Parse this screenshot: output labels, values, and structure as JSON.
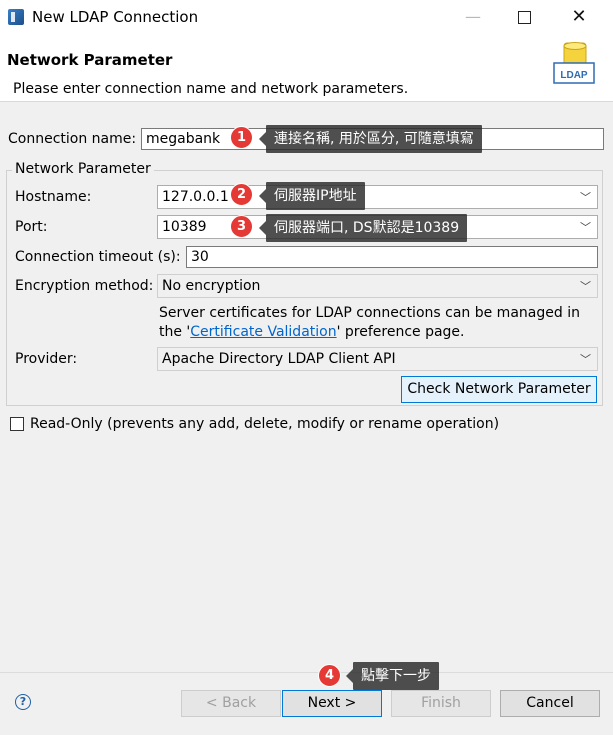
{
  "window": {
    "title": "New LDAP Connection",
    "minimize_symbol": "—",
    "close_symbol": "✕"
  },
  "header": {
    "title": "Network Parameter",
    "description": "Please enter connection name and network parameters.",
    "logo_text": "LDAP"
  },
  "form": {
    "connection_name": {
      "label": "Connection name:",
      "value": "megabank"
    },
    "group_title": "Network Parameter",
    "hostname": {
      "label": "Hostname:",
      "value": "127.0.0.1"
    },
    "port": {
      "label": "Port:",
      "value": "10389"
    },
    "timeout": {
      "label": "Connection timeout (s):",
      "value": "30"
    },
    "encryption": {
      "label": "Encryption method:",
      "value": "No encryption"
    },
    "cert_note": {
      "line1": "Server certificates for LDAP connections can be managed in",
      "line2_prefix": "the '",
      "link": "Certificate Validation",
      "line2_suffix": "' preference page."
    },
    "provider": {
      "label": "Provider:",
      "value": "Apache Directory LDAP Client API"
    },
    "check_button": "Check Network Parameter",
    "readonly_label": "Read-Only (prevents any add, delete, modify or rename operation)"
  },
  "footer": {
    "help_symbol": "?",
    "back": "< Back",
    "next": "Next >",
    "finish": "Finish",
    "cancel": "Cancel"
  },
  "annotations": [
    {
      "num": "1",
      "text": "連接名稱, 用於區分, 可隨意填寫"
    },
    {
      "num": "2",
      "text": "伺服器IP地址"
    },
    {
      "num": "3",
      "text": "伺服器端口, DS默認是10389"
    },
    {
      "num": "4",
      "text": "點擊下一步"
    }
  ],
  "colors": {
    "badge": "#e53935",
    "accent": "#0078d7",
    "link": "#0066cc"
  }
}
